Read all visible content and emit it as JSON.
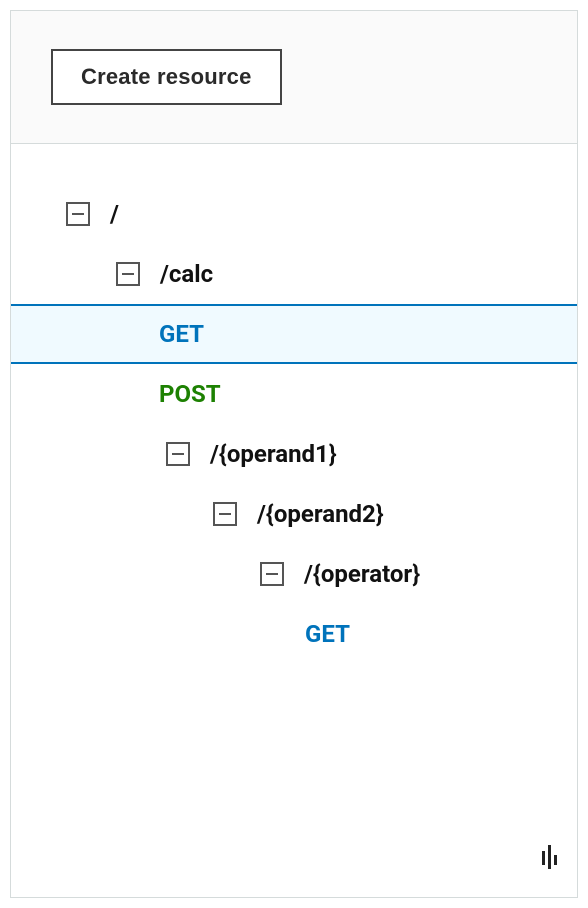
{
  "header": {
    "create_resource_label": "Create resource"
  },
  "tree": {
    "root": {
      "label": "/",
      "calc": {
        "label": "/calc",
        "get": "GET",
        "post": "POST",
        "operand1": {
          "label": "/{operand1}",
          "operand2": {
            "label": "/{operand2}",
            "operator": {
              "label": "/{operator}",
              "get": "GET"
            }
          }
        }
      }
    }
  }
}
